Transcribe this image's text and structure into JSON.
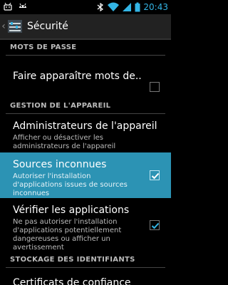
{
  "statusbar": {
    "time": "20:43"
  },
  "actionbar": {
    "title": "Sécurité"
  },
  "list": {
    "section_passwords": "MOTS DE PASSE",
    "show_passwords": {
      "title": "Faire apparaître mots de..",
      "checked": false
    },
    "section_device": "GESTION DE L'APPAREIL",
    "device_admin": {
      "title": "Administrateurs de l'appareil",
      "summary": "Afficher ou désactiver les administrateurs de l'appareil"
    },
    "unknown_sources": {
      "title": "Sources inconnues",
      "summary": "Autoriser l'installation d'applications issues de sources inconnues",
      "checked": true
    },
    "verify_apps": {
      "title": "Vérifier les applications",
      "summary": "Ne pas autoriser l'installation d'applications potentiellement dangereuses ou afficher un avertissement",
      "checked": true
    },
    "section_credentials": "STOCKAGE DES IDENTIFIANTS",
    "trusted_certs": {
      "title": "Certificats de confiance"
    }
  },
  "colors": {
    "highlight": "#2c93b4",
    "accent": "#33b5e5"
  }
}
